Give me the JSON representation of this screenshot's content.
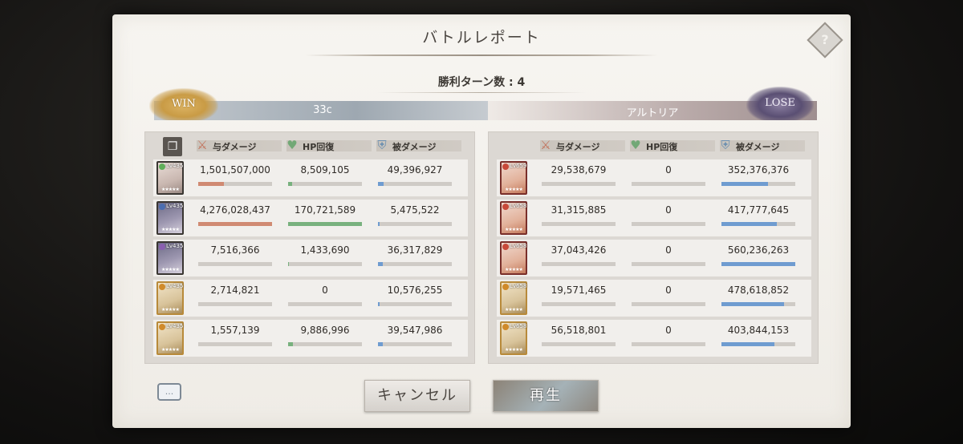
{
  "dialog": {
    "title": "バトルレポート",
    "help_label": "?",
    "turns_label": "勝利ターン数 : 4",
    "win_label": "WIN",
    "lose_label": "LOSE",
    "cancel_label": "キャンセル",
    "play_label": "再生",
    "chat_label": "..."
  },
  "headers": {
    "damage": "与ダメージ",
    "heal": "HP回復",
    "taken": "被ダメージ"
  },
  "player": {
    "name": "33c",
    "rows": [
      {
        "lv": "Lv435",
        "damage": "1,501,507,000",
        "heal": "8,509,105",
        "taken": "49,396,927",
        "damage_ratio": 0.35,
        "heal_ratio": 0.05,
        "taken_ratio": 0.08
      },
      {
        "lv": "Lv435",
        "damage": "4,276,028,437",
        "heal": "170,721,589",
        "taken": "5,475,522",
        "damage_ratio": 1.0,
        "heal_ratio": 1.0,
        "taken_ratio": 0.02
      },
      {
        "lv": "Lv435",
        "damage": "7,516,366",
        "heal": "1,433,690",
        "taken": "36,317,829",
        "damage_ratio": 0.0,
        "heal_ratio": 0.01,
        "taken_ratio": 0.06
      },
      {
        "lv": "Lv435",
        "damage": "2,714,821",
        "heal": "0",
        "taken": "10,576,255",
        "damage_ratio": 0.0,
        "heal_ratio": 0.0,
        "taken_ratio": 0.02
      },
      {
        "lv": "Lv435",
        "damage": "1,557,139",
        "heal": "9,886,996",
        "taken": "39,547,986",
        "damage_ratio": 0.0,
        "heal_ratio": 0.06,
        "taken_ratio": 0.07
      }
    ]
  },
  "enemy": {
    "name": "アルトリア",
    "rows": [
      {
        "lv": "Lv659",
        "damage": "29,538,679",
        "heal": "0",
        "taken": "352,376,376",
        "damage_ratio": 0.0,
        "heal_ratio": 0.0,
        "taken_ratio": 0.63
      },
      {
        "lv": "Lv658",
        "damage": "31,315,885",
        "heal": "0",
        "taken": "417,777,645",
        "damage_ratio": 0.0,
        "heal_ratio": 0.0,
        "taken_ratio": 0.75
      },
      {
        "lv": "Lv658",
        "damage": "37,043,426",
        "heal": "0",
        "taken": "560,236,263",
        "damage_ratio": 0.0,
        "heal_ratio": 0.0,
        "taken_ratio": 1.0
      },
      {
        "lv": "Lv658",
        "damage": "19,571,465",
        "heal": "0",
        "taken": "478,618,852",
        "damage_ratio": 0.0,
        "heal_ratio": 0.0,
        "taken_ratio": 0.85
      },
      {
        "lv": "Lv658",
        "damage": "56,518,801",
        "heal": "0",
        "taken": "403,844,153",
        "damage_ratio": 0.0,
        "heal_ratio": 0.0,
        "taken_ratio": 0.72
      }
    ]
  },
  "icons": {
    "damage": "sword-icon",
    "heal": "heart-icon",
    "taken": "shield-icon",
    "copy": "copy-icon",
    "chat": "chat-icon",
    "help": "help-icon"
  },
  "colors": {
    "damage_bar": "#d08a72",
    "heal_bar": "#78b17e",
    "taken_bar": "#6f9cd0",
    "win_badge": "#c99b45",
    "lose_badge": "#5a4f73"
  }
}
